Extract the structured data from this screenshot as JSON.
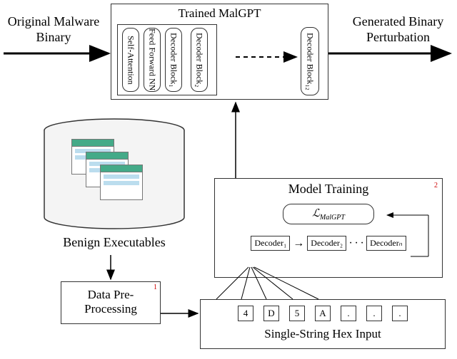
{
  "inputLabel": "Original Malware Binary",
  "outputLabel": "Generated Binary Perturbation",
  "trainedBox": {
    "title": "Trained MalGPT",
    "blocks": [
      "Self-Attention",
      "Feed Forward NN",
      "Decoder Block₁",
      "Decoder Block₂",
      "Decoder Block₁₂"
    ]
  },
  "benignLabel": "Benign Executables",
  "preProc": {
    "label": "Data Pre-Processing",
    "sup": "1"
  },
  "training": {
    "title": "Model Training",
    "sup": "2",
    "loss": "ℒ_MalGPT",
    "decoders": [
      "Decoder₁",
      "Decoder₂",
      "Decoderₙ"
    ],
    "dots": "∙ ∙ ∙"
  },
  "hex": {
    "cells": [
      "4",
      "D",
      "5",
      "A",
      ".",
      ".",
      "."
    ],
    "label": "Single-String Hex Input"
  }
}
